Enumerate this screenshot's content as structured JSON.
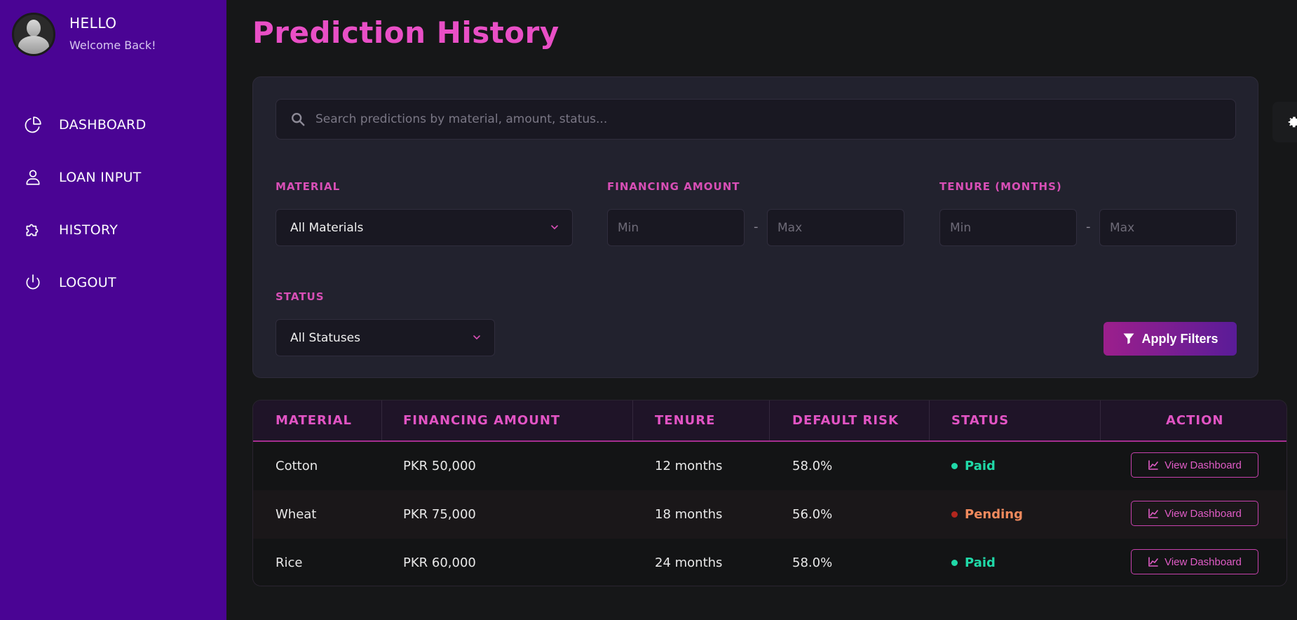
{
  "sidebar": {
    "greeting": "HELLO",
    "welcome": "Welcome Back!",
    "items": [
      {
        "label": "DASHBOARD",
        "icon": "pie-chart-icon"
      },
      {
        "label": "LOAN INPUT",
        "icon": "user-icon"
      },
      {
        "label": "HISTORY",
        "icon": "puzzle-icon"
      },
      {
        "label": "LOGOUT",
        "icon": "power-icon"
      }
    ]
  },
  "page": {
    "title": "Prediction History"
  },
  "filters": {
    "search_placeholder": "Search predictions by material, amount, status...",
    "material_label": "MATERIAL",
    "material_value": "All Materials",
    "amount_label": "FINANCING AMOUNT",
    "amount_min_placeholder": "Min",
    "amount_max_placeholder": "Max",
    "tenure_label": "TENURE (MONTHS)",
    "tenure_min_placeholder": "Min",
    "tenure_max_placeholder": "Max",
    "range_separator": "-",
    "status_label": "STATUS",
    "status_value": "All Statuses",
    "apply_label": "Apply Filters"
  },
  "table": {
    "headers": [
      "MATERIAL",
      "FINANCING AMOUNT",
      "TENURE",
      "DEFAULT RISK",
      "STATUS",
      "ACTION"
    ],
    "rows": [
      {
        "material": "Cotton",
        "amount": "PKR 50,000",
        "tenure": "12 months",
        "risk": "58.0%",
        "status": "Paid",
        "action": "View Dashboard"
      },
      {
        "material": "Wheat",
        "amount": "PKR 75,000",
        "tenure": "18 months",
        "risk": "56.0%",
        "status": "Pending",
        "action": "View Dashboard"
      },
      {
        "material": "Rice",
        "amount": "PKR 60,000",
        "tenure": "24 months",
        "risk": "58.0%",
        "status": "Paid",
        "action": "View Dashboard"
      }
    ]
  },
  "colors": {
    "sidebar_bg": "#4a0494",
    "accent": "#e94fc6",
    "paid": "#20d9a8",
    "pending": "#f08a5d",
    "pending_dot": "#b3261e"
  }
}
